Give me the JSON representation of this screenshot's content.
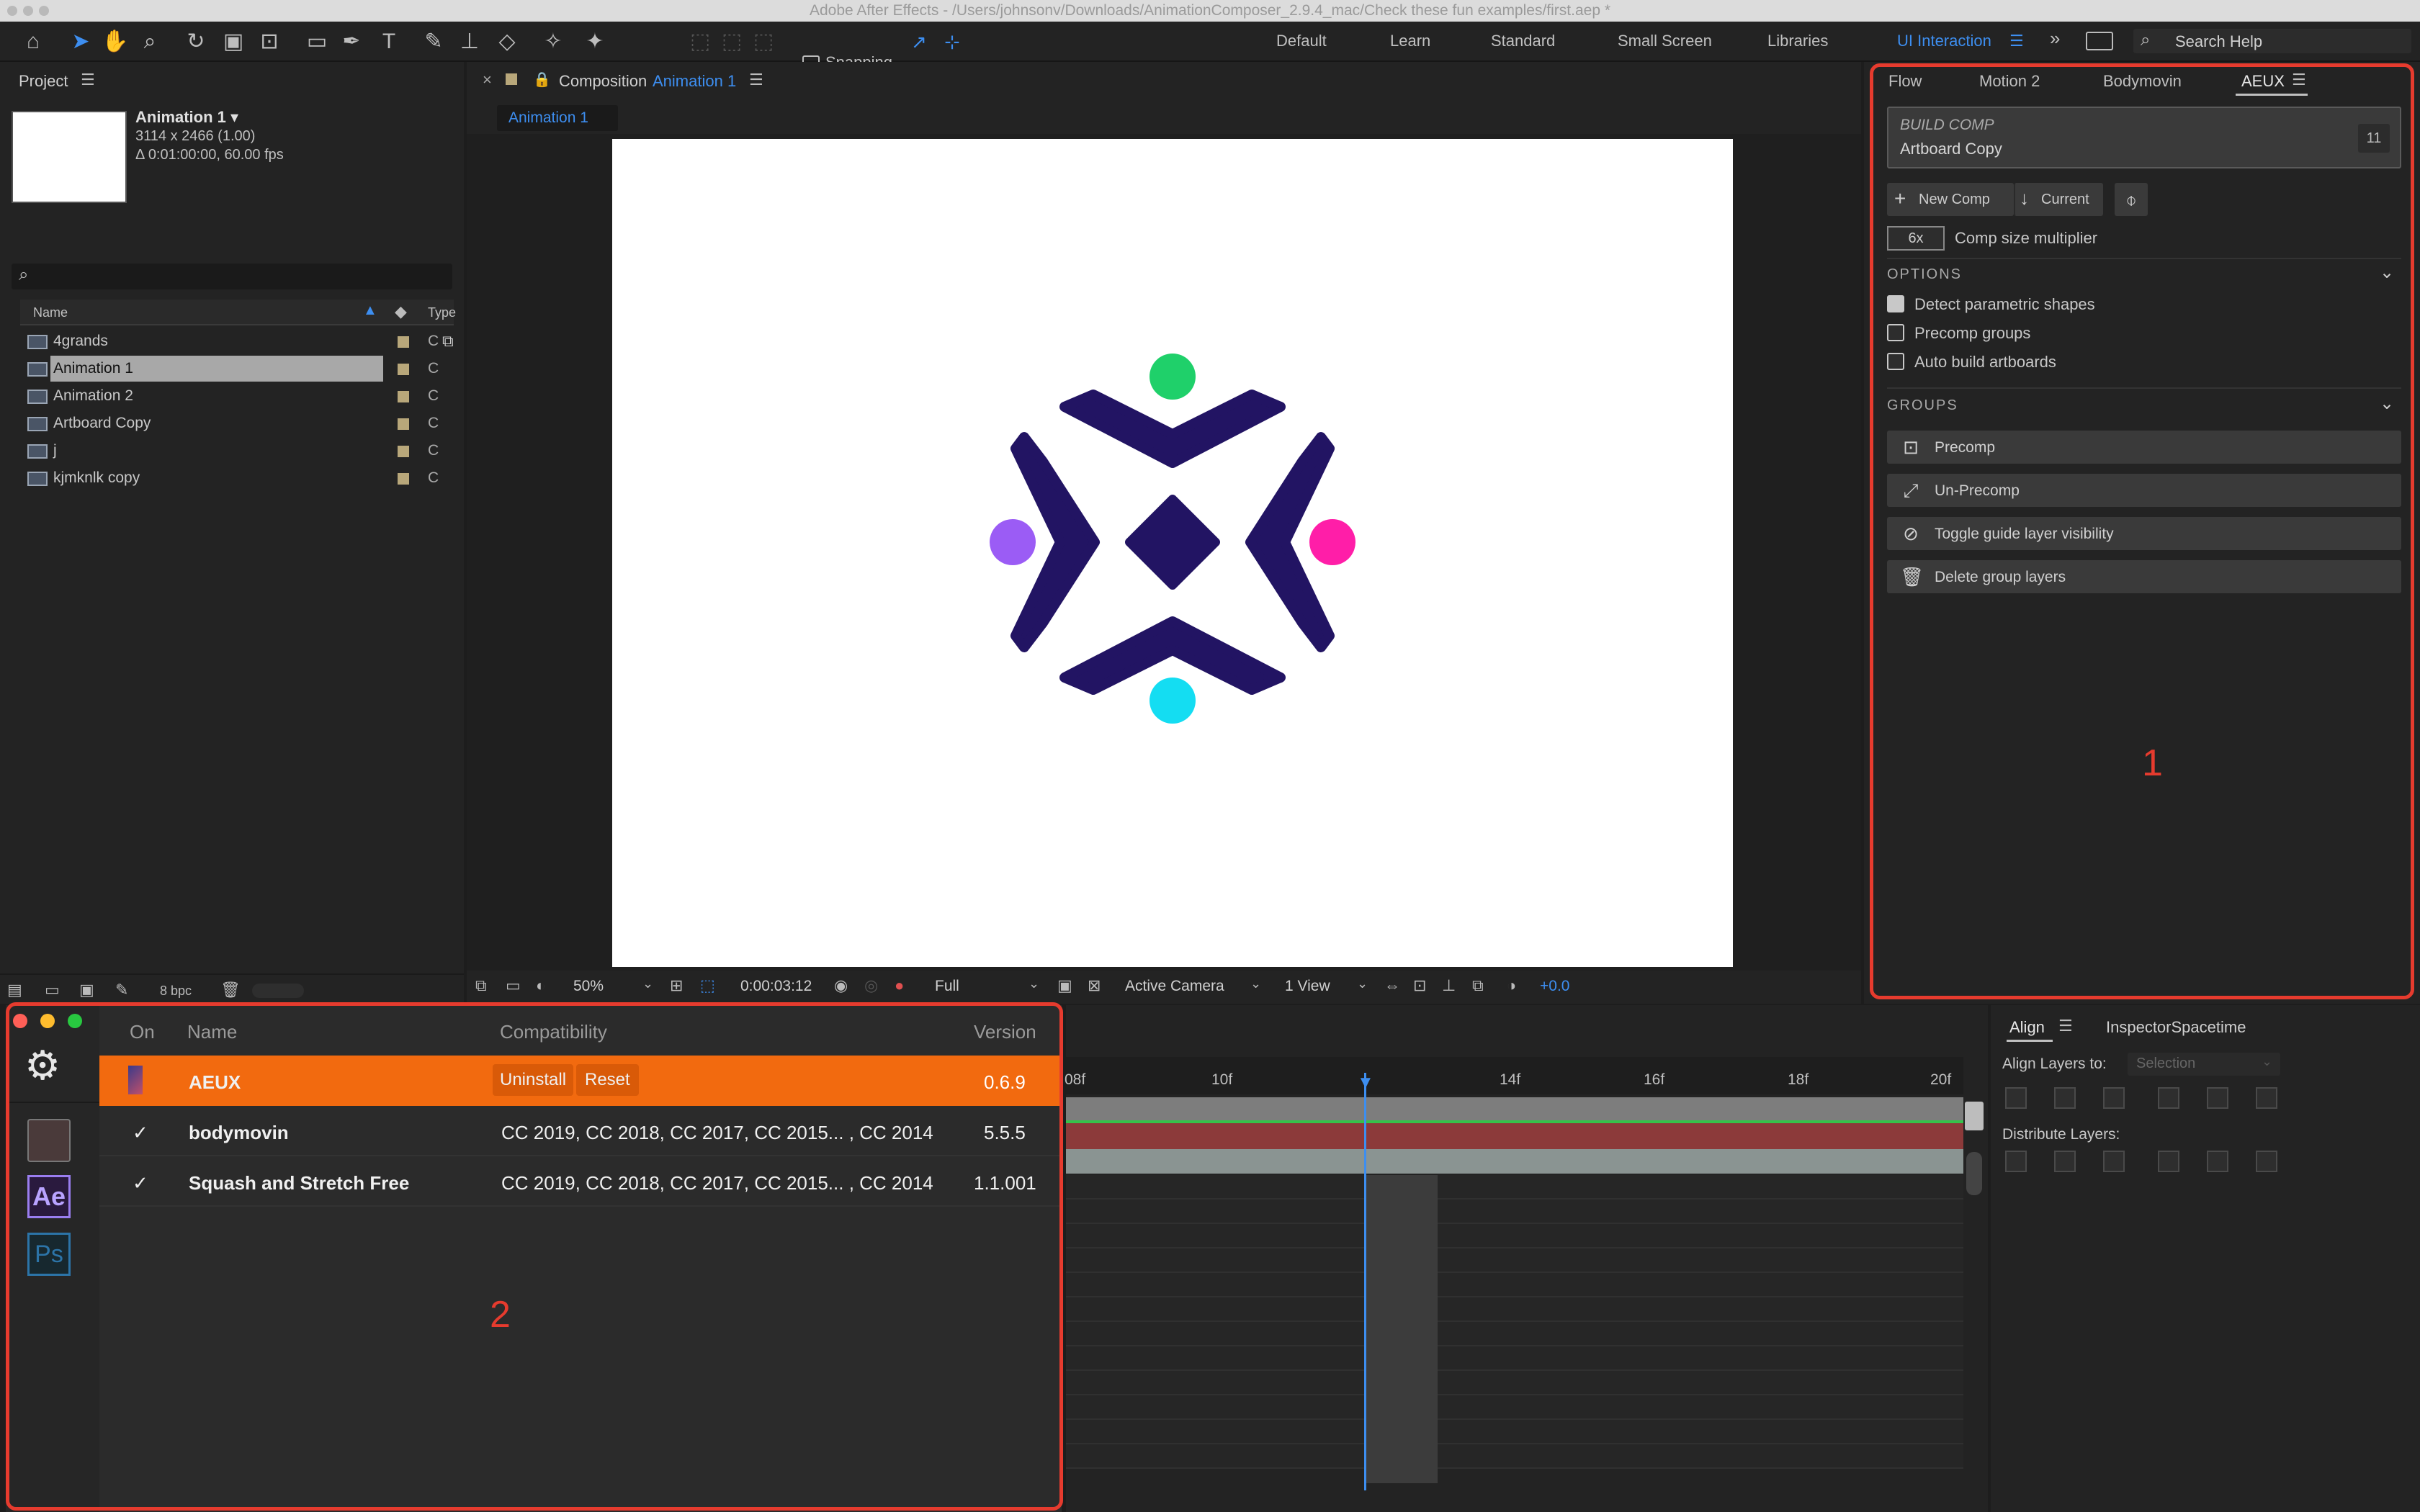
{
  "window": {
    "title": "Adobe After Effects - /Users/johnsonv/Downloads/AnimationComposer_2.9.4_mac/Check these fun examples/first.aep *"
  },
  "toolbar": {
    "snapping_label": "Snapping",
    "workspaces": [
      "Default",
      "Learn",
      "Standard",
      "Small Screen",
      "Libraries"
    ],
    "active_workspace": "UI Interaction",
    "search_placeholder": "Search Help"
  },
  "project": {
    "tab_label": "Project",
    "selected_name": "Animation 1 ▾",
    "selected_dims": "3114 x 2466 (1.00)",
    "selected_duration": "Δ 0:01:00:00, 60.00 fps",
    "col_name": "Name",
    "col_type": "Type",
    "items": [
      {
        "name": "4grands",
        "type": "C"
      },
      {
        "name": "Animation 1",
        "type": "C"
      },
      {
        "name": "Animation 2",
        "type": "C"
      },
      {
        "name": "Artboard Copy",
        "type": "C"
      },
      {
        "name": "j",
        "type": "C"
      },
      {
        "name": "kjmknlk copy",
        "type": "C"
      }
    ],
    "bpc": "8 bpc"
  },
  "composition": {
    "prefix": "Composition",
    "name": "Animation 1",
    "sub_tab": "Animation 1",
    "zoom": "50%",
    "timecode": "0:00:03:12",
    "resolution": "Full",
    "camera": "Active Camera",
    "views": "1 View",
    "exposure": "+0.0"
  },
  "aeux": {
    "tabs": [
      "Flow",
      "Motion 2",
      "Bodymovin",
      "AEUX"
    ],
    "active_tab": "AEUX",
    "build_title": "BUILD COMP",
    "build_subtitle": "Artboard Copy",
    "build_count": "11",
    "new_comp": "New Comp",
    "current": "Current",
    "multiplier_value": "6x",
    "multiplier_label": "Comp size multiplier",
    "options_label": "OPTIONS",
    "options": [
      {
        "label": "Detect parametric shapes",
        "checked": true
      },
      {
        "label": "Precomp groups",
        "checked": false
      },
      {
        "label": "Auto build artboards",
        "checked": false
      }
    ],
    "groups_label": "GROUPS",
    "groups": [
      {
        "label": "Precomp",
        "icon": "precomp-icon"
      },
      {
        "label": "Un-Precomp",
        "icon": "expand-icon"
      },
      {
        "label": "Toggle guide layer visibility",
        "icon": "eye-slash-icon"
      },
      {
        "label": "Delete group layers",
        "icon": "trash-icon"
      }
    ]
  },
  "annotations": {
    "one": "1",
    "two": "2"
  },
  "ext_manager": {
    "col_on": "On",
    "col_name": "Name",
    "col_compat": "Compatibility",
    "col_version": "Version",
    "apps": [
      "Ae",
      "Ps"
    ],
    "rows": [
      {
        "name": "AEUX",
        "compat": "",
        "version": "0.6.9",
        "uninstall": "Uninstall",
        "reset": "Reset",
        "selected": true
      },
      {
        "name": "bodymovin",
        "compat": "CC 2019, CC 2018, CC 2017, CC 2015... , CC 2014",
        "version": "5.5.5",
        "selected": false
      },
      {
        "name": "Squash and Stretch Free",
        "compat": "CC 2019, CC 2018, CC 2017, CC 2015... , CC 2014",
        "version": "1.1.001",
        "selected": false
      }
    ]
  },
  "timeline": {
    "ticks": [
      "08f",
      "10f",
      "",
      "14f",
      "16f",
      "18f",
      "20f"
    ]
  },
  "align": {
    "tab": "Align",
    "tab2": "InspectorSpacetime",
    "align_to_label": "Align Layers to:",
    "align_to_value": "Selection",
    "distribute_label": "Distribute Layers:"
  },
  "colors": {
    "accent_blue": "#3d8ef0",
    "selection_orange": "#f26a0f",
    "annotation_red": "#e63b2e",
    "logo_navy": "#221463"
  }
}
